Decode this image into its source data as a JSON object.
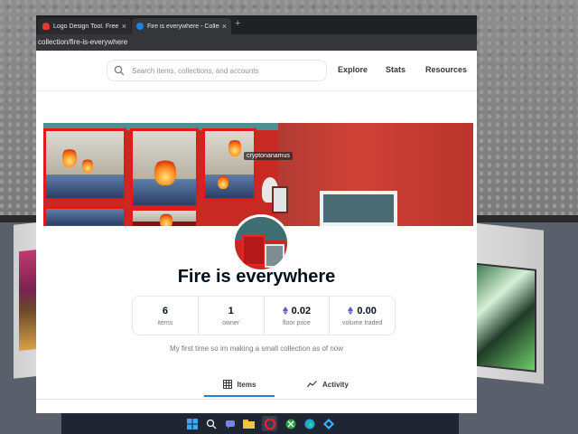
{
  "browser": {
    "tabs": [
      {
        "title": "Logo Design Tool. Free and",
        "favicon": "flame-favicon-icon"
      },
      {
        "title": "Fire is everywhere - Collect",
        "favicon": "opensea-favicon-icon"
      }
    ],
    "new_tab": "+",
    "url": "collection/fire-is-everywhere"
  },
  "header": {
    "search_placeholder": "Search items, collections, and accounts",
    "nav": [
      "Explore",
      "Stats",
      "Resources"
    ]
  },
  "banner": {
    "username_tag": "cryptonanamus"
  },
  "collection": {
    "title": "Fire is everywhere",
    "stats": [
      {
        "value": "6",
        "label": "items",
        "eth": false
      },
      {
        "value": "1",
        "label": "owner",
        "eth": false
      },
      {
        "value": "0.02",
        "label": "floor price",
        "eth": true
      },
      {
        "value": "0.00",
        "label": "volume traded",
        "eth": true
      }
    ],
    "description": "My first time so im making a small collection as of now"
  },
  "page_tabs": {
    "items": "Items",
    "activity": "Activity"
  },
  "colors": {
    "accent": "#2081e2",
    "eth": "#5c59d9",
    "title": "#04111d",
    "muted": "#707a83"
  },
  "taskbar": {
    "icons": [
      "windows-start-icon",
      "search-icon",
      "chat-icon",
      "file-explorer-icon",
      "opera-browser-icon",
      "xbox-icon",
      "edge-browser-icon",
      "vscode-icon"
    ]
  }
}
